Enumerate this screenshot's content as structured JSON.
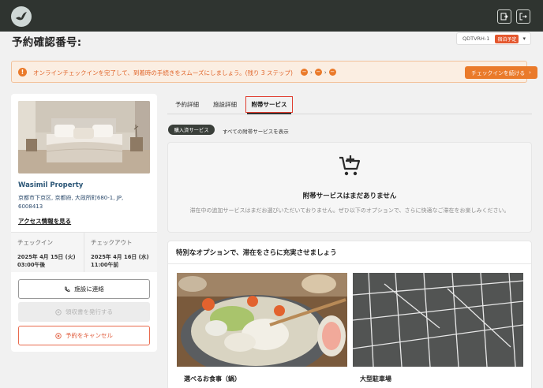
{
  "header": {
    "logo_icon": "bird-logo-icon",
    "actions": [
      {
        "icon": "export-icon"
      },
      {
        "icon": "logout-icon"
      }
    ]
  },
  "page": {
    "title": "予約確認番号:",
    "booking_code": "QDTVRH-1",
    "booking_status": "宿泊予定",
    "booking_status_color": "#e4572e"
  },
  "notice": {
    "icon": "info-icon",
    "text": "オンラインチェックインを完了して、到着時の手続きをスムーズにしましょう。(残り 3 ステップ)",
    "steps": [
      "−",
      "−",
      "−"
    ],
    "step_separator": "›",
    "button_label": "チェックインを続ける",
    "button_chevron": "›",
    "accent_color": "#ea7a2a"
  },
  "property": {
    "name": "Wasimil Property",
    "address": "京都市下京区, 京都府, 大政所町680-1, JP, 6008413",
    "access_link": "アクセス情報を見る",
    "checkin_label": "チェックイン",
    "checkin_date": "2025年 4月 15日 (火)",
    "checkin_time": "03:00午後",
    "checkout_label": "チェックアウト",
    "checkout_date": "2025年 4月 16日 (水)",
    "checkout_time": "11:00午前",
    "contact_button": "施設に連絡",
    "contact_icon": "phone-icon",
    "receipt_button": "領収書を発行する",
    "receipt_icon": "receipt-icon",
    "cancel_button": "予約をキャンセル",
    "cancel_icon": "cancel-circle-icon"
  },
  "tabs": [
    {
      "label": "予約詳細"
    },
    {
      "label": "施設詳細"
    },
    {
      "label": "附帯サービス",
      "active": true
    }
  ],
  "filters": {
    "purchased": "購入済サービス",
    "show_all": "すべての附帯サービスを表示"
  },
  "empty_state": {
    "icon": "cart-add-icon",
    "title": "附帯サービスはまだありません",
    "description": "滞在中の追加サービスはまだお選びいただいておりません。ぜひ以下のオプションで、さらに快適なご滞在をお楽しみください。"
  },
  "options": {
    "title": "特別なオプションで、滞在をさらに充実させましょう",
    "items": [
      {
        "name": "選べるお食事（鍋）",
        "image": "hot-pot-photo"
      },
      {
        "name": "大型駐車場",
        "image": "parking-lot-photo"
      }
    ]
  }
}
